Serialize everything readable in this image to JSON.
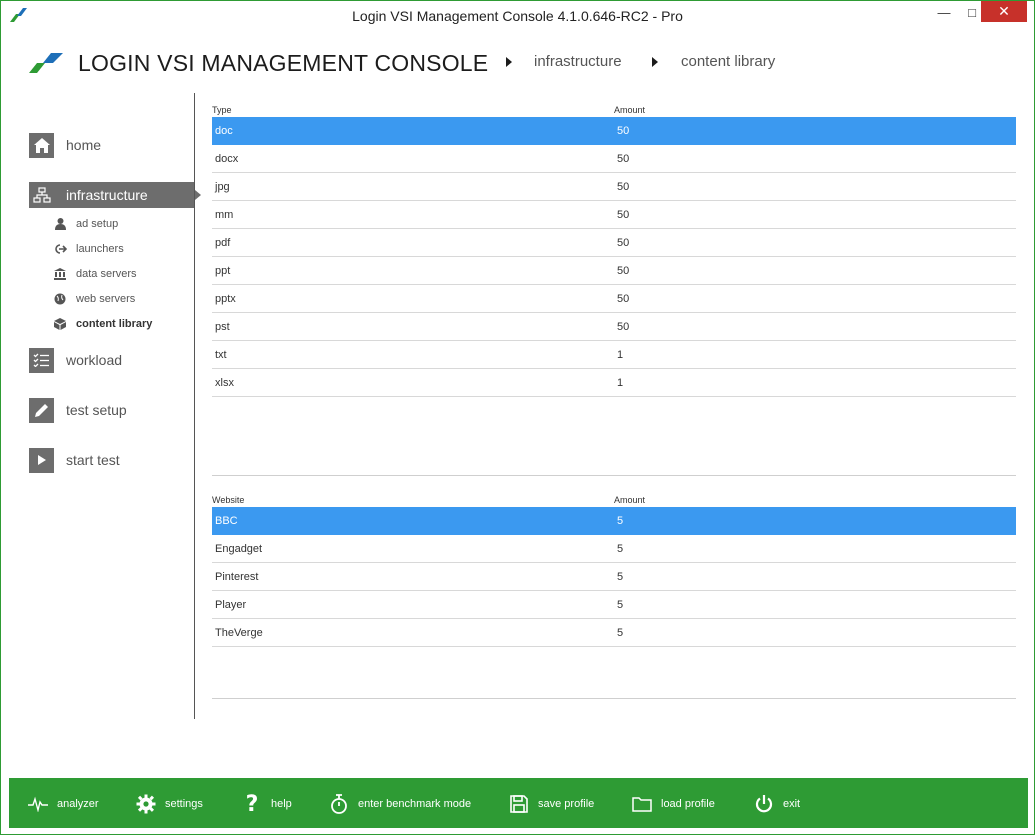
{
  "window": {
    "title": "Login VSI Management Console 4.1.0.646-RC2 - Pro",
    "minimize": "—",
    "maximize": "□",
    "close": "✕"
  },
  "header": {
    "brand": "LOGIN VSI MANAGEMENT CONSOLE",
    "breadcrumb": [
      "infrastructure",
      "content library"
    ]
  },
  "sidebar": {
    "items": [
      {
        "label": "home",
        "icon": "home-icon"
      },
      {
        "label": "infrastructure",
        "icon": "network-icon",
        "active": true
      },
      {
        "label": "workload",
        "icon": "checklist-icon"
      },
      {
        "label": "test setup",
        "icon": "pencil-icon"
      },
      {
        "label": "start test",
        "icon": "play-icon"
      }
    ],
    "subitems": [
      {
        "label": "ad setup",
        "icon": "user-icon"
      },
      {
        "label": "launchers",
        "icon": "launch-icon"
      },
      {
        "label": "data servers",
        "icon": "bank-icon"
      },
      {
        "label": "web servers",
        "icon": "globe-icon"
      },
      {
        "label": "content library",
        "icon": "box-icon",
        "active": true
      }
    ]
  },
  "files_table": {
    "columns": [
      "Type",
      "Amount"
    ],
    "rows": [
      {
        "type": "doc",
        "amount": "50",
        "selected": true
      },
      {
        "type": "docx",
        "amount": "50"
      },
      {
        "type": "jpg",
        "amount": "50"
      },
      {
        "type": "mm",
        "amount": "50"
      },
      {
        "type": "pdf",
        "amount": "50"
      },
      {
        "type": "ppt",
        "amount": "50"
      },
      {
        "type": "pptx",
        "amount": "50"
      },
      {
        "type": "pst",
        "amount": "50"
      },
      {
        "type": "txt",
        "amount": "1"
      },
      {
        "type": "xlsx",
        "amount": "1"
      }
    ]
  },
  "websites_table": {
    "columns": [
      "Website",
      "Amount"
    ],
    "rows": [
      {
        "website": "BBC",
        "amount": "5",
        "selected": true
      },
      {
        "website": "Engadget",
        "amount": "5"
      },
      {
        "website": "Pinterest",
        "amount": "5"
      },
      {
        "website": "Player",
        "amount": "5"
      },
      {
        "website": "TheVerge",
        "amount": "5"
      }
    ]
  },
  "footer": {
    "buttons": [
      {
        "label": "analyzer",
        "icon": "pulse-icon"
      },
      {
        "label": "settings",
        "icon": "gear-icon"
      },
      {
        "label": "help",
        "icon": "question-icon"
      },
      {
        "label": "enter benchmark mode",
        "icon": "stopwatch-icon"
      },
      {
        "label": "save profile",
        "icon": "floppy-icon"
      },
      {
        "label": "load profile",
        "icon": "folder-icon"
      },
      {
        "label": "exit",
        "icon": "power-icon"
      }
    ]
  },
  "colors": {
    "accent_green": "#2e9b34",
    "selection_blue": "#3b99f0",
    "nav_gray": "#6d6d6d",
    "close_red": "#c7312a"
  }
}
